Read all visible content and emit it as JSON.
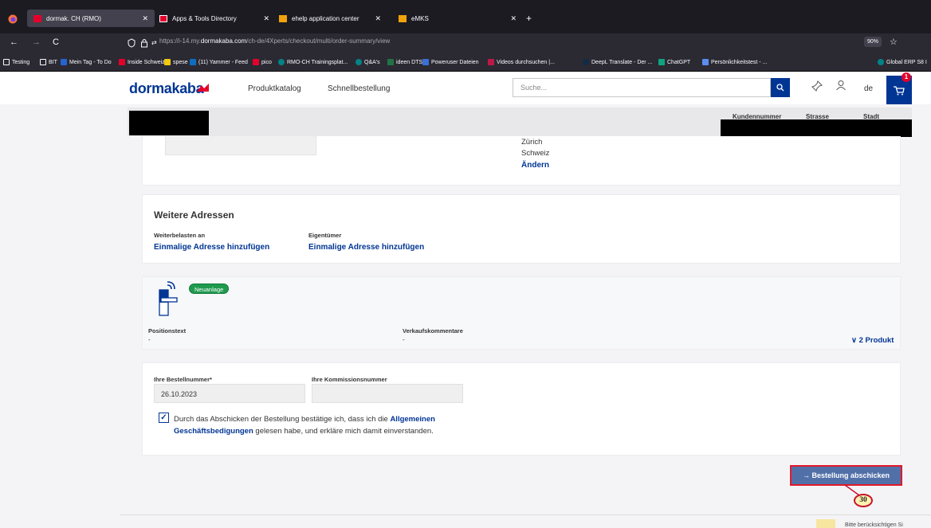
{
  "browser": {
    "tabs": [
      {
        "label": "dormak. CH (RMO)",
        "active": true
      },
      {
        "label": "Apps & Tools Directory",
        "active": false
      },
      {
        "label": "ehelp application center",
        "active": false
      },
      {
        "label": "eMKS",
        "active": false
      }
    ],
    "new_tab": "+",
    "url_prefix": "https://i-14.my.",
    "url_domain": "dormakaba.com",
    "url_path": "/ch-de/4Xperts/checkout/multi/order-summary/view",
    "zoom": "90%",
    "bookmarks": [
      "Testing",
      "BIT",
      "Mein Tag - To Do",
      "Inside Schweiz",
      "spese",
      "(11) Yammer - Feed",
      "pico",
      "RMO-CH Trainingsplat...",
      "Q&A's",
      "ideen DTS",
      "Poweruser Dateien",
      "Videos durchsuchen |...",
      "DeepL Translate - Der ...",
      "ChatGPT",
      "Persönlichkeitstest - ...",
      "Global ERP S8 I"
    ]
  },
  "header": {
    "logo": "dormakaba",
    "nav": [
      "Produktkatalog",
      "Schnellbestellung"
    ],
    "search_placeholder": "Suche...",
    "lang": "de",
    "cart_count": "1"
  },
  "sticky": {
    "columns": [
      "Kundennummer",
      "Strasse",
      "Stadt"
    ]
  },
  "address": {
    "city": "Zürich",
    "country": "Schweiz",
    "change_link": "Ändern"
  },
  "further_addresses": {
    "title": "Weitere Adressen",
    "col1_label": "Weiterbelasten an",
    "col1_link": "Einmalige Adresse hinzufügen",
    "col2_label": "Eigentümer",
    "col2_link": "Einmalige Adresse hinzufügen"
  },
  "position": {
    "badge": "Neuanlage",
    "positionstext_label": "Positionstext",
    "positionstext_value": "-",
    "verkauf_label": "Verkaufskommentare",
    "verkauf_value": "-",
    "products_toggle": "2 Produkt"
  },
  "order": {
    "bestellnummer_label": "Ihre Bestellnummer*",
    "bestellnummer_value": "26.10.2023",
    "kommission_label": "Ihre Kommissionsnummer",
    "kommission_value": "",
    "agree_1": "Durch das Abschicken der Bestellung bestätige ich, dass ich die ",
    "agree_link_1": "Allgemeinen",
    "agree_link_2": "Geschäftsbedigungen",
    "agree_2": " gelesen habe, und erkläre mich damit einverstanden.",
    "agree_checked": true
  },
  "submit": {
    "label": "→ Bestellung abschicken",
    "step_number": "30"
  },
  "footer": {
    "note": "Bitte berücksichtigen Si"
  },
  "colors": {
    "brand": "#003594",
    "badge_green": "#1f9a4e",
    "highlight_red": "#e2192c"
  }
}
